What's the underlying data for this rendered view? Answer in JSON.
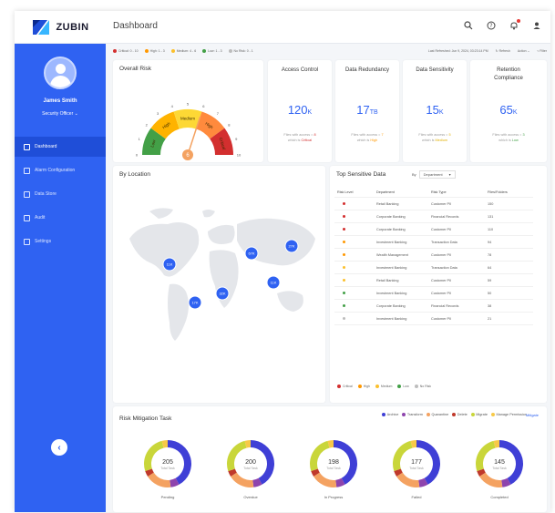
{
  "app": {
    "logo_text": "ZUBIN",
    "page_title": "Dashboard"
  },
  "top_icons": [
    "search-icon",
    "help-icon",
    "notification-icon",
    "user-icon"
  ],
  "sidebar": {
    "user_name": "James Smith",
    "user_role": "Security Officer",
    "items": [
      {
        "label": "Dashboard",
        "icon": "dashboard-icon",
        "active": true
      },
      {
        "label": "Alarm Configuration",
        "icon": "alarm-icon",
        "active": false
      },
      {
        "label": "Data Store",
        "icon": "database-icon",
        "active": false
      },
      {
        "label": "Audit",
        "icon": "audit-icon",
        "active": false
      },
      {
        "label": "Settings",
        "icon": "settings-icon",
        "active": false
      }
    ]
  },
  "filter_bar": {
    "legend": [
      {
        "label": "Critical: 0 - 10",
        "color": "#d32f2f"
      },
      {
        "label": "High: 1 - 3",
        "color": "#ff9800"
      },
      {
        "label": "Medium: 4 - 6",
        "color": "#fbc02d"
      },
      {
        "label": "Low: 1 - 3",
        "color": "#43a047"
      },
      {
        "label": "No Risk: 0 - 1",
        "color": "#bdbdbd"
      }
    ],
    "last_refreshed": "Last Refreshed: Jun 9, 2024, 03:23:14 PM",
    "refresh_label": "Refresh",
    "action_label": "Action",
    "filter_label": "Filter"
  },
  "overall_risk": {
    "title": "Overall Risk",
    "score": 6,
    "segments": [
      {
        "label": "Low",
        "color": "#43a047"
      },
      {
        "label": "High",
        "color": "#ffb300"
      },
      {
        "label": "Medium",
        "color": "#fdd835"
      },
      {
        "label": "High",
        "color": "#ff8a3d"
      },
      {
        "label": "Critical",
        "color": "#d32f2f"
      }
    ],
    "ticks": [
      "0",
      "1",
      "2",
      "3",
      "4",
      "5",
      "6",
      "7",
      "8",
      "9",
      "10"
    ]
  },
  "kpis": [
    {
      "title": "Access Control",
      "value": "120",
      "unit": "K",
      "note_pre": "Files with access = ",
      "note_num": "8",
      "note_mid": " which is ",
      "note_level": "Critical",
      "level_color": "#d32f2f"
    },
    {
      "title": "Data Redundancy",
      "value": "17",
      "unit": "TB",
      "note_pre": "Files with access = ",
      "note_num": "7",
      "note_mid": " which is ",
      "note_level": "High",
      "level_color": "#ff9800"
    },
    {
      "title": "Data Sensitivity",
      "value": "15",
      "unit": "K",
      "note_pre": "Files with access = ",
      "note_num": "5",
      "note_mid": " which is ",
      "note_level": "Medium",
      "level_color": "#e0b000"
    },
    {
      "title": "Retention Compliance",
      "value": "65",
      "unit": "K",
      "note_pre": "Files with access = ",
      "note_num": "3",
      "note_mid": " which is ",
      "note_level": "Low",
      "level_color": "#43a047"
    }
  ],
  "location": {
    "title": "By Location",
    "markers": [
      "11K",
      "67K",
      "27K",
      "11K",
      "17K",
      "32K"
    ]
  },
  "sensitive": {
    "title": "Top Sensitive Data",
    "by_label": "By",
    "dropdown": "Department",
    "headers": [
      "Risk Level",
      "Department",
      "Risk Type",
      "Files/Folders"
    ],
    "rows": [
      {
        "color": "#d32f2f",
        "dept": "Retail Banking",
        "type": "Customer PII",
        "files": "150"
      },
      {
        "color": "#d32f2f",
        "dept": "Corporate Banking",
        "type": "Financial Records",
        "files": "131"
      },
      {
        "color": "#d32f2f",
        "dept": "Corporate Banking",
        "type": "Customer PII",
        "files": "110"
      },
      {
        "color": "#ff9800",
        "dept": "Investment Banking",
        "type": "Transaction Data",
        "files": "94"
      },
      {
        "color": "#ff9800",
        "dept": "Wealth Management",
        "type": "Customer PII",
        "files": "78"
      },
      {
        "color": "#fbc02d",
        "dept": "Investment Banking",
        "type": "Transaction Data",
        "files": "64"
      },
      {
        "color": "#fbc02d",
        "dept": "Retail Banking",
        "type": "Customer PII",
        "files": "59"
      },
      {
        "color": "#43a047",
        "dept": "Investment Banking",
        "type": "Customer PII",
        "files": "50"
      },
      {
        "color": "#43a047",
        "dept": "Corporate Banking",
        "type": "Financial Records",
        "files": "38"
      },
      {
        "color": "#bdbdbd",
        "dept": "Investment Banking",
        "type": "Customer PII",
        "files": "21"
      }
    ],
    "legend": [
      {
        "label": "Critical",
        "color": "#d32f2f"
      },
      {
        "label": "High",
        "color": "#ff9800"
      },
      {
        "label": "Medium",
        "color": "#fbc02d"
      },
      {
        "label": "Low",
        "color": "#43a047"
      },
      {
        "label": "No Risk",
        "color": "#bdbdbd"
      }
    ]
  },
  "mitigation": {
    "title": "Risk Mitigation Task",
    "legend": [
      {
        "label": "Archive",
        "color": "#3f3fd6"
      },
      {
        "label": "Transform",
        "color": "#8e44ad"
      },
      {
        "label": "Quarantine",
        "color": "#f4a261"
      },
      {
        "label": "Delete",
        "color": "#c0392b"
      },
      {
        "label": "Migrate",
        "color": "#c9d63a"
      },
      {
        "label": "Manage Permission",
        "color": "#f7c948"
      }
    ],
    "link": "Mitigate",
    "donuts": [
      {
        "value": "205",
        "sub": "Total Task",
        "label": "Pending"
      },
      {
        "value": "200",
        "sub": "Total Task",
        "label": "Overdue"
      },
      {
        "value": "198",
        "sub": "Total Task",
        "label": "In Progress"
      },
      {
        "value": "177",
        "sub": "Total Task",
        "label": "Failed"
      },
      {
        "value": "145",
        "sub": "Total Task",
        "label": "Completed"
      }
    ],
    "segment_fractions": [
      0.42,
      0.06,
      0.18,
      0.04,
      0.26,
      0.04
    ]
  }
}
